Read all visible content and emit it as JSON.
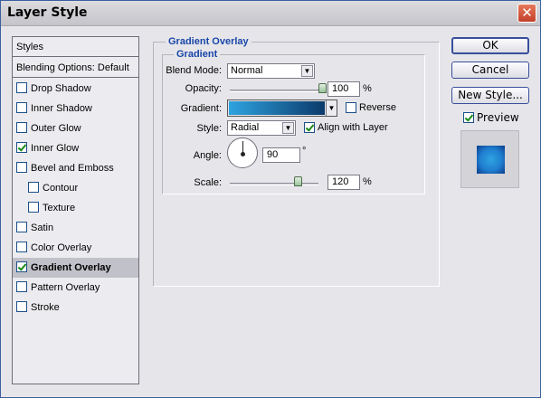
{
  "window": {
    "title": "Layer Style",
    "close": "✕"
  },
  "sidebar": {
    "header": "Styles",
    "blending": "Blending Options: Default",
    "items": [
      {
        "label": "Drop Shadow",
        "checked": false
      },
      {
        "label": "Inner Shadow",
        "checked": false
      },
      {
        "label": "Outer Glow",
        "checked": false
      },
      {
        "label": "Inner Glow",
        "checked": true
      },
      {
        "label": "Bevel and Emboss",
        "checked": false
      },
      {
        "label": "Contour",
        "checked": false
      },
      {
        "label": "Texture",
        "checked": false
      },
      {
        "label": "Satin",
        "checked": false
      },
      {
        "label": "Color Overlay",
        "checked": false
      },
      {
        "label": "Gradient Overlay",
        "checked": true
      },
      {
        "label": "Pattern Overlay",
        "checked": false
      },
      {
        "label": "Stroke",
        "checked": false
      }
    ]
  },
  "gradient_overlay": {
    "title": "Gradient Overlay",
    "subtitle": "Gradient",
    "blend_mode_label": "Blend Mode:",
    "blend_mode_value": "Normal",
    "opacity_label": "Opacity:",
    "opacity_value": "100",
    "opacity_percent": 100,
    "percent_sign": "%",
    "gradient_label": "Gradient:",
    "reverse_label": "Reverse",
    "reverse_checked": false,
    "style_label": "Style:",
    "style_value": "Radial",
    "align_label": "Align with Layer",
    "align_checked": true,
    "angle_label": "Angle:",
    "angle_value": "90",
    "degree_sign": "°",
    "scale_label": "Scale:",
    "scale_value": "120",
    "scale_slider_fraction": 0.78
  },
  "buttons": {
    "ok": "OK",
    "cancel": "Cancel",
    "new_style": "New Style..."
  },
  "preview": {
    "label": "Preview",
    "checked": true
  },
  "colors": {
    "gradient_dark": "#0a3a6a",
    "gradient_light": "#2fa3e0",
    "preview_center": "#1f7ed0",
    "preview_edge": "#0a3d8a"
  }
}
